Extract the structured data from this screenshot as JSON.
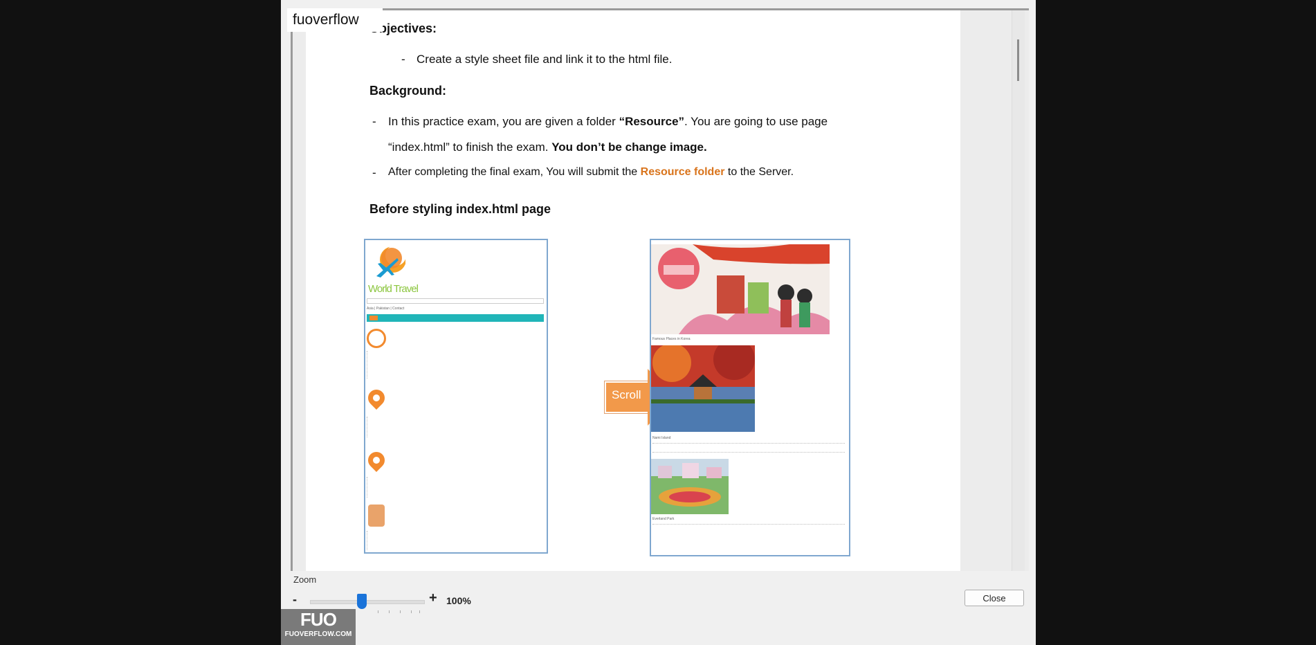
{
  "watermark_top": "fuoverflow",
  "doc": {
    "objectives_heading": "Objectives:",
    "objective_bullet": "-",
    "objective_item": "Create a style sheet file and link it to the html file.",
    "background_heading": "Background:",
    "bg_bullet": "-",
    "bg_line1_a": "In this practice exam, you are given a folder ",
    "bg_line1_b": "“Resource”",
    "bg_line1_c": ". You are going to use page",
    "bg_line2_a": "“index.html”  to finish the exam. ",
    "bg_line2_b": "You don’t be change image.",
    "bg_line3_a": "After completing the final exam, You will submit the ",
    "bg_line3_b": "Resource folder",
    "bg_line3_c": " to the Server.",
    "before_heading": "Before styling index.html page",
    "left_shot": {
      "brand": "World Travel",
      "nav_text": "Asia | Pakistan | Contact"
    },
    "arrow_label": "Scroll",
    "right_shot": {
      "caption1": "Famous Places in Korea",
      "caption2": "Nami Island",
      "caption3": "Everland Park"
    }
  },
  "zoom": {
    "label": "Zoom",
    "minus": "-",
    "plus": "+",
    "value": "100%",
    "level_fraction": 0.45
  },
  "close_label": "Close",
  "watermark": {
    "logo": "FUO",
    "site": "FUOVERFLOW.COM"
  },
  "colors": {
    "accent_orange": "#d9741c",
    "slider_blue": "#1a73d9",
    "teal_nav": "#20b5b8"
  }
}
